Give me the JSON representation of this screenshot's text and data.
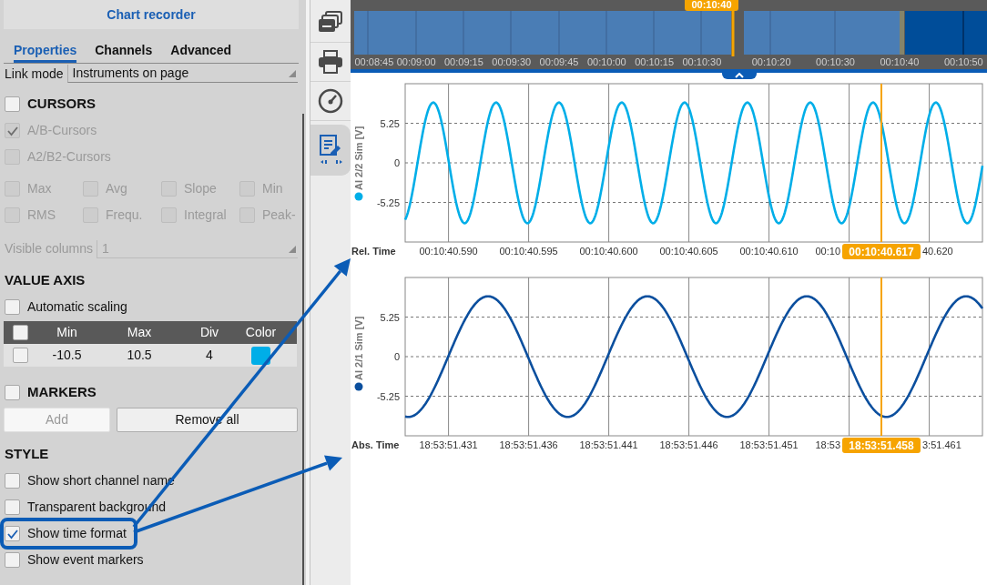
{
  "panel": {
    "title": "Chart recorder",
    "tabs": [
      {
        "label": "Properties",
        "selected": true
      },
      {
        "label": "Channels",
        "selected": false
      },
      {
        "label": "Advanced",
        "selected": false
      }
    ],
    "link_mode": {
      "label": "Link mode",
      "value": "Instruments on page"
    },
    "items": [
      {
        "kind": "section",
        "label": "CURSORS",
        "checked": false
      },
      {
        "kind": "check",
        "label": "A/B-Cursors",
        "checked": true,
        "disabled": true,
        "highlighted": false
      },
      {
        "kind": "check",
        "label": "A2/B2-Cursors",
        "checked": false,
        "disabled": true,
        "highlighted": false
      },
      {
        "kind": "grid",
        "disabled": true,
        "options": [
          {
            "label": "Max",
            "checked": false
          },
          {
            "label": "Avg",
            "checked": false
          },
          {
            "label": "Slope",
            "checked": false
          },
          {
            "label": "Min",
            "checked": false
          },
          {
            "label": "RMS",
            "checked": false
          },
          {
            "label": "Frequ.",
            "checked": false
          },
          {
            "label": "Integral",
            "checked": false
          },
          {
            "label": "Peak-",
            "checked": false
          }
        ]
      },
      {
        "kind": "select",
        "label": "Visible columns",
        "value": "1",
        "disabled": true
      },
      {
        "kind": "heading",
        "label": "VALUE AXIS"
      },
      {
        "kind": "check",
        "label": "Automatic scaling",
        "checked": false,
        "disabled": false,
        "highlighted": false
      },
      {
        "kind": "table",
        "header_checked": false,
        "columns": [
          "Min",
          "Max",
          "Div",
          "Color"
        ],
        "rows": [
          {
            "checked": false,
            "cells": [
              "-10.5",
              "10.5",
              "4"
            ],
            "color": "#00aee8"
          }
        ]
      },
      {
        "kind": "section",
        "label": "MARKERS",
        "checked": false
      },
      {
        "kind": "buttons",
        "buttons": [
          {
            "label": "Add",
            "disabled": true
          },
          {
            "label": "Remove all",
            "disabled": false
          }
        ]
      },
      {
        "kind": "heading",
        "label": "STYLE"
      },
      {
        "kind": "check",
        "label": "Show short channel name",
        "checked": false,
        "disabled": false,
        "highlighted": false
      },
      {
        "kind": "check",
        "label": "Transparent background",
        "checked": false,
        "disabled": false,
        "highlighted": false
      },
      {
        "kind": "check",
        "label": "Show time format",
        "checked": true,
        "disabled": false,
        "highlighted": true
      },
      {
        "kind": "check",
        "label": "Show event markers",
        "checked": false,
        "disabled": false,
        "highlighted": false
      }
    ]
  },
  "toolbar": [
    {
      "kind": "windows",
      "selected": false
    },
    {
      "kind": "printer",
      "selected": false
    },
    {
      "kind": "gauge",
      "selected": false
    },
    {
      "kind": "report",
      "selected": true
    }
  ],
  "timeline": {
    "position": "00:10:40",
    "overview_ticks": [
      "00:08:45",
      "00:09:00",
      "00:09:15",
      "00:09:30",
      "00:09:45",
      "00:10:00",
      "00:10:15",
      "00:10:30"
    ],
    "detail_ticks": [
      "00:10:20",
      "00:10:30",
      "00:10:40",
      "00:10:50"
    ]
  },
  "charts": [
    {
      "channel": "AI 2/2 Sim [V]",
      "color": "#00aee8",
      "time_label": "Rel. Time",
      "y_ticks": [
        "5.25",
        "0",
        "-5.25"
      ],
      "cursor": {
        "label": "00:10:40.617",
        "tick_before": "00:10",
        "tick_after": "40.620"
      },
      "x_ticks": [
        "00:10:40.590",
        "00:10:40.595",
        "00:10:40.600",
        "00:10:40.605",
        "00:10:40.610"
      ]
    },
    {
      "channel": "AI 2/1 Sim [V]",
      "color": "#0b4f9e",
      "time_label": "Abs. Time",
      "y_ticks": [
        "5.25",
        "0",
        "-5.25"
      ],
      "cursor": {
        "label": "18:53:51.458",
        "tick_before": "18:53",
        "tick_after": "3:51.461"
      },
      "x_ticks": [
        "18:53:51.431",
        "18:53:51.436",
        "18:53:51.441",
        "18:53:51.446",
        "18:53:51.451"
      ]
    }
  ]
}
